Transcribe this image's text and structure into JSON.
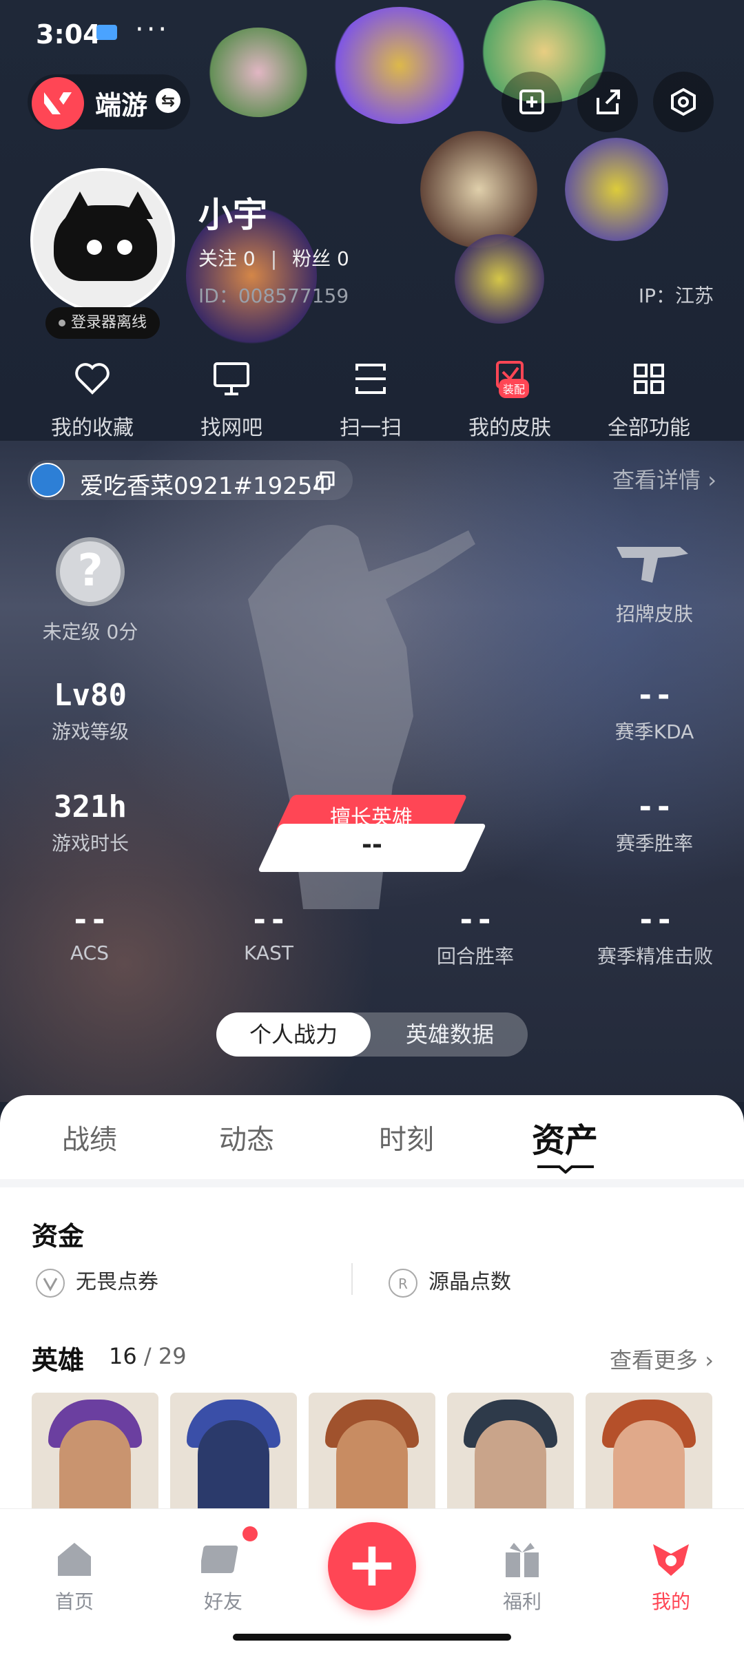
{
  "status_bar": {
    "time": "3:04",
    "dots": "···"
  },
  "app": {
    "name": "端游"
  },
  "profile": {
    "nickname": "小宇",
    "follow_text": "关注 0",
    "fans_text": "粉丝 0",
    "id_text": "ID：008577159",
    "ip_text": "IP：江苏",
    "login_status": "登录器离线"
  },
  "quick_actions": [
    {
      "label": "我的收藏",
      "icon": "heart-icon"
    },
    {
      "label": "找网吧",
      "icon": "monitor-icon"
    },
    {
      "label": "扫一扫",
      "icon": "scan-icon"
    },
    {
      "label": "我的皮肤",
      "icon": "skin-icon",
      "tag": "装配"
    },
    {
      "label": "全部功能",
      "icon": "grid-icon"
    }
  ],
  "player": {
    "name": "爱吃香菜0921#19254",
    "detail_link": "查看详情 ›"
  },
  "stats": {
    "rank_label": "未定级 0分",
    "rank_symbol": "?",
    "signature_skin_label": "招牌皮肤",
    "level_value": "Lv80",
    "level_label": "游戏等级",
    "kda_value": "--",
    "kda_label": "赛季KDA",
    "time_value": "321h",
    "time_label": "游戏时长",
    "winrate_value": "--",
    "winrate_label": "赛季胜率",
    "acs_value": "--",
    "acs_label": "ACS",
    "kast_value": "--",
    "kast_label": "KAST",
    "round_win_value": "--",
    "round_win_label": "回合胜率",
    "precise_value": "--",
    "precise_label": "赛季精准击败",
    "best_hero_label": "擅长英雄",
    "best_hero_value": "--"
  },
  "toggle": {
    "active": "个人战力",
    "inactive": "英雄数据"
  },
  "tabs": [
    "战绩",
    "动态",
    "时刻",
    "资产"
  ],
  "funds": {
    "title": "资金",
    "item1": "无畏点券",
    "item2": "源晶点数"
  },
  "heroes": {
    "title": "英雄",
    "owned": "16",
    "total": "/ 29",
    "more": "查看更多 ›"
  },
  "agents": [
    {
      "face": "#c9946f",
      "hair": "#6b3fa0"
    },
    {
      "face": "#2b3a6b",
      "hair": "#3a4fa8"
    },
    {
      "face": "#c88c62",
      "hair": "#a0522d"
    },
    {
      "face": "#c9a48a",
      "hair": "#2e3a4a"
    },
    {
      "face": "#e0a98a",
      "hair": "#b5502a"
    }
  ],
  "bottom_nav": [
    {
      "label": "首页",
      "icon": "home-icon"
    },
    {
      "label": "好友",
      "icon": "friends-icon"
    },
    {
      "label": "福利",
      "icon": "gift-icon"
    },
    {
      "label": "我的",
      "icon": "me-icon"
    }
  ],
  "colors": {
    "accent": "#ff4655"
  }
}
